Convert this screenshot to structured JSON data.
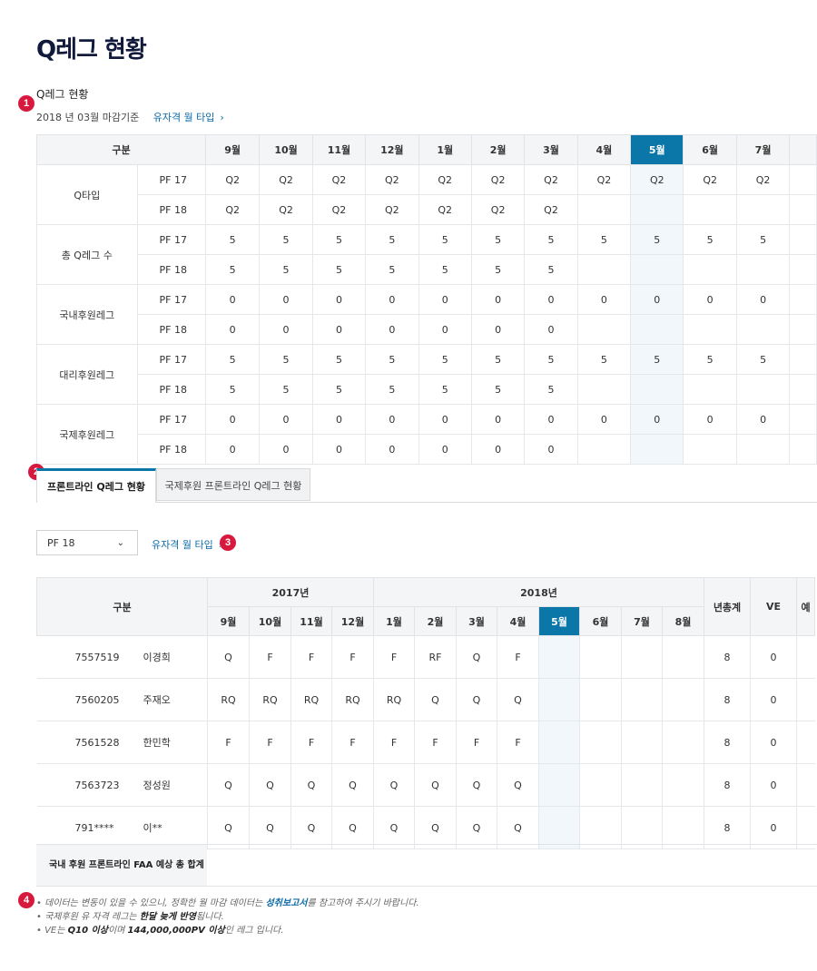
{
  "page_title": "Q레그 현황",
  "section1": {
    "title": "Q레그 현황",
    "date_text": "2018 년 03월 마감기준",
    "link_label": "유자격 월 타입",
    "badge": "1"
  },
  "table1": {
    "headers": [
      "구분",
      "9월",
      "10월",
      "11월",
      "12월",
      "1월",
      "2월",
      "3월",
      "4월",
      "5월",
      "6월",
      "7월"
    ],
    "current_col": "5월",
    "groups": [
      {
        "label": "Q타입",
        "rows": [
          {
            "pf": "PF 17",
            "values": [
              "Q2",
              "Q2",
              "Q2",
              "Q2",
              "Q2",
              "Q2",
              "Q2",
              "Q2",
              "Q2",
              "Q2",
              "Q2"
            ]
          },
          {
            "pf": "PF 18",
            "values": [
              "Q2",
              "Q2",
              "Q2",
              "Q2",
              "Q2",
              "Q2",
              "Q2",
              "",
              "",
              "",
              ""
            ]
          }
        ]
      },
      {
        "label": "총 Q레그 수",
        "rows": [
          {
            "pf": "PF 17",
            "values": [
              "5",
              "5",
              "5",
              "5",
              "5",
              "5",
              "5",
              "5",
              "5",
              "5",
              "5"
            ]
          },
          {
            "pf": "PF 18",
            "values": [
              "5",
              "5",
              "5",
              "5",
              "5",
              "5",
              "5",
              "",
              "",
              "",
              ""
            ]
          }
        ]
      },
      {
        "label": "국내후원레그",
        "rows": [
          {
            "pf": "PF 17",
            "values": [
              "0",
              "0",
              "0",
              "0",
              "0",
              "0",
              "0",
              "0",
              "0",
              "0",
              "0"
            ]
          },
          {
            "pf": "PF 18",
            "values": [
              "0",
              "0",
              "0",
              "0",
              "0",
              "0",
              "0",
              "",
              "",
              "",
              ""
            ]
          }
        ]
      },
      {
        "label": "대리후원레그",
        "rows": [
          {
            "pf": "PF 17",
            "values": [
              "5",
              "5",
              "5",
              "5",
              "5",
              "5",
              "5",
              "5",
              "5",
              "5",
              "5"
            ]
          },
          {
            "pf": "PF 18",
            "values": [
              "5",
              "5",
              "5",
              "5",
              "5",
              "5",
              "5",
              "",
              "",
              "",
              ""
            ]
          }
        ]
      },
      {
        "label": "국제후원레그",
        "rows": [
          {
            "pf": "PF 17",
            "values": [
              "0",
              "0",
              "0",
              "0",
              "0",
              "0",
              "0",
              "0",
              "0",
              "0",
              "0"
            ]
          },
          {
            "pf": "PF 18",
            "values": [
              "0",
              "0",
              "0",
              "0",
              "0",
              "0",
              "0",
              "",
              "",
              "",
              ""
            ]
          }
        ]
      }
    ]
  },
  "tabs": {
    "badge": "2",
    "active": "프론트라인 Q레그 현황",
    "inactive": "국제후원 프론트라인 Q레그 현황"
  },
  "filter": {
    "selected": "PF 18",
    "link_label": "유자격 월 타입",
    "badge": "3"
  },
  "table2": {
    "header_label": "구분",
    "year1": "2017년",
    "year2": "2018년",
    "months": [
      "9월",
      "10월",
      "11월",
      "12월",
      "1월",
      "2월",
      "3월",
      "4월",
      "5월",
      "6월",
      "7월",
      "8월"
    ],
    "current_col": "5월",
    "total_label": "년총계",
    "ve_label": "VE",
    "extra_label": "예",
    "rows": [
      {
        "id": "7557519",
        "name": "이경희",
        "values": [
          "Q",
          "F",
          "F",
          "F",
          "F",
          "RF",
          "Q",
          "F",
          "",
          "",
          "",
          ""
        ],
        "total": "8",
        "ve": "0"
      },
      {
        "id": "7560205",
        "name": "주재오",
        "values": [
          "RQ",
          "RQ",
          "RQ",
          "RQ",
          "RQ",
          "Q",
          "Q",
          "Q",
          "",
          "",
          "",
          ""
        ],
        "total": "8",
        "ve": "0"
      },
      {
        "id": "7561528",
        "name": "한민학",
        "values": [
          "F",
          "F",
          "F",
          "F",
          "F",
          "F",
          "F",
          "F",
          "",
          "",
          "",
          ""
        ],
        "total": "8",
        "ve": "0"
      },
      {
        "id": "7563723",
        "name": "정성원",
        "values": [
          "Q",
          "Q",
          "Q",
          "Q",
          "Q",
          "Q",
          "Q",
          "Q",
          "",
          "",
          "",
          ""
        ],
        "total": "8",
        "ve": "0"
      },
      {
        "id": "791****",
        "name": "이**",
        "values": [
          "Q",
          "Q",
          "Q",
          "Q",
          "Q",
          "Q",
          "Q",
          "Q",
          "",
          "",
          "",
          ""
        ],
        "total": "8",
        "ve": "0"
      }
    ]
  },
  "summary": {
    "label": "국내 후원 프론트라인 FAA 예상 총 합계"
  },
  "notes": {
    "badge": "4",
    "n1_a": "데이터는 변동이 있을 수 있으니, 정확한 월 마감 데이터는 ",
    "n1_hl": "성취보고서",
    "n1_b": "를 참고하여 주시기 바랍니다.",
    "n2_a": "국제후원 유 자격 레그는 ",
    "n2_hl": "한달 늦게 반영",
    "n2_b": "됩니다.",
    "n3_a": "VE는 ",
    "n3_hl1": "Q10 이상",
    "n3_mid": "이며 ",
    "n3_hl2": "144,000,000PV 이상",
    "n3_b": "인 레그 입니다."
  },
  "colors": {
    "accent": "#0b77a8",
    "badge": "#d7193e",
    "title": "#111a3a"
  }
}
